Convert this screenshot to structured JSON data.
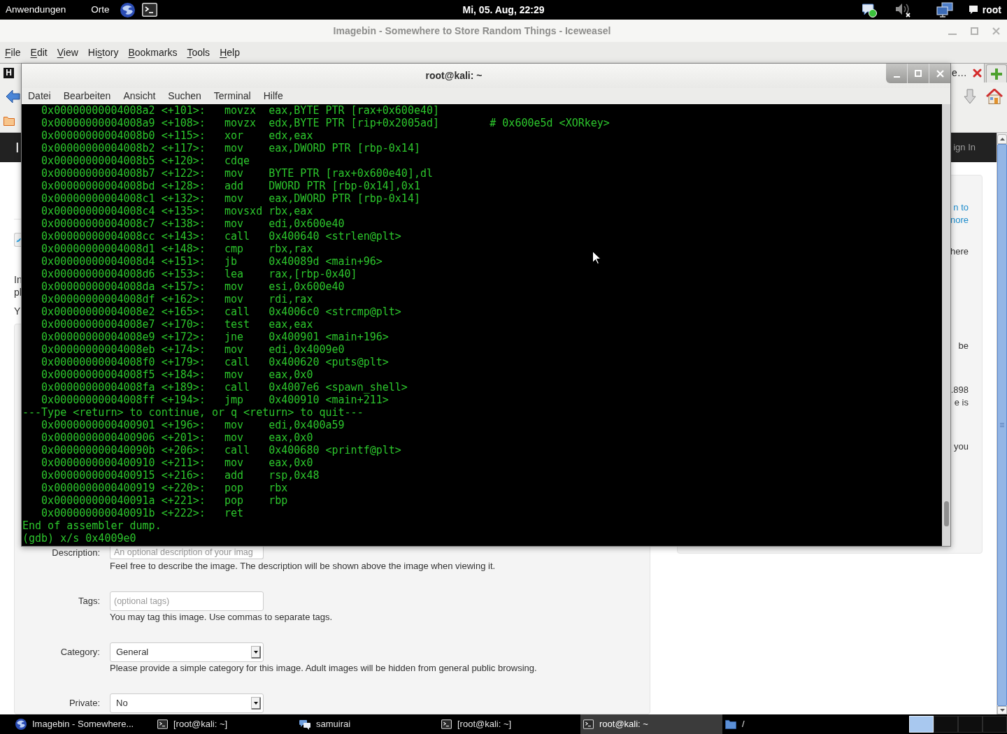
{
  "top_panel": {
    "menus": [
      "Anwendungen",
      "Orte"
    ],
    "clock": "Mi, 05. Aug, 22:29",
    "user": "root"
  },
  "browser": {
    "title": "Imagebin - Somewhere to Store Random Things - Iceweasel",
    "active": false,
    "menu": [
      {
        "key": "F",
        "rest": "ile"
      },
      {
        "key": "E",
        "rest": "dit"
      },
      {
        "key": "V",
        "rest": "iew"
      },
      {
        "lead": "Hi",
        "key": "s",
        "rest": "tory"
      },
      {
        "key": "B",
        "rest": "ookmarks"
      },
      {
        "key": "T",
        "rest": "ools"
      },
      {
        "key": "H",
        "rest": "elp"
      }
    ],
    "tab": {
      "favicon_letter": "H",
      "title_end": "e…"
    },
    "header": {
      "site_title_start": "I",
      "sign_in_end": "ign In"
    },
    "content": {
      "paragraph_line_starts": [
        "In",
        "pl"
      ],
      "note_start": "Y"
    },
    "sidebar_paragraphs": [
      {
        "kind": "link",
        "lines": [
          "n to",
          "nore"
        ]
      },
      {
        "kind": "text",
        "lines": [
          "here"
        ]
      },
      {
        "kind": "text",
        "lines": [
          "be"
        ]
      },
      {
        "kind": "text",
        "lines": [
          ".898",
          "e is"
        ]
      },
      {
        "kind": "text",
        "lines": [
          "you"
        ]
      }
    ],
    "form": [
      {
        "kind": "input",
        "label": "Description:",
        "placeholder": "An optional description of your imag",
        "help": "Feel free to describe the image. The description will be shown above the image when viewing it."
      },
      {
        "kind": "input",
        "label": "Tags:",
        "placeholder": "(optional tags)",
        "help": "You may tag this image. Use commas to separate tags."
      },
      {
        "kind": "select",
        "label": "Category:",
        "value": "General",
        "help": "Please provide a simple category for this image. Adult images will be hidden from general public browsing."
      },
      {
        "kind": "select",
        "label": "Private:",
        "value": "No"
      }
    ]
  },
  "terminal": {
    "title": "root@kali: ~",
    "active": true,
    "menu": [
      "Datei",
      "Bearbeiten",
      "Ansicht",
      "Suchen",
      "Terminal",
      "Hilfe"
    ],
    "lines": [
      "   0x00000000004008a2 <+101>:   movzx  eax,BYTE PTR [rax+0x600e40]",
      "   0x00000000004008a9 <+108>:   movzx  edx,BYTE PTR [rip+0x2005ad]        # 0x600e5d <XORkey>",
      "   0x00000000004008b0 <+115>:   xor    edx,eax",
      "   0x00000000004008b2 <+117>:   mov    eax,DWORD PTR [rbp-0x14]",
      "   0x00000000004008b5 <+120>:   cdqe",
      "   0x00000000004008b7 <+122>:   mov    BYTE PTR [rax+0x600e40],dl",
      "   0x00000000004008bd <+128>:   add    DWORD PTR [rbp-0x14],0x1",
      "   0x00000000004008c1 <+132>:   mov    eax,DWORD PTR [rbp-0x14]",
      "   0x00000000004008c4 <+135>:   movsxd rbx,eax",
      "   0x00000000004008c7 <+138>:   mov    edi,0x600e40",
      "   0x00000000004008cc <+143>:   call   0x400640 <strlen@plt>",
      "   0x00000000004008d1 <+148>:   cmp    rbx,rax",
      "   0x00000000004008d4 <+151>:   jb     0x40089d <main+96>",
      "   0x00000000004008d6 <+153>:   lea    rax,[rbp-0x40]",
      "   0x00000000004008da <+157>:   mov    esi,0x600e40",
      "   0x00000000004008df <+162>:   mov    rdi,rax",
      "   0x00000000004008e2 <+165>:   call   0x4006c0 <strcmp@plt>",
      "   0x00000000004008e7 <+170>:   test   eax,eax",
      "   0x00000000004008e9 <+172>:   jne    0x400901 <main+196>",
      "   0x00000000004008eb <+174>:   mov    edi,0x4009e0",
      "   0x00000000004008f0 <+179>:   call   0x400620 <puts@plt>",
      "   0x00000000004008f5 <+184>:   mov    eax,0x0",
      "   0x00000000004008fa <+189>:   call   0x4007e6 <spawn_shell>",
      "   0x00000000004008ff <+194>:   jmp    0x400910 <main+211>",
      "---Type <return> to continue, or q <return> to quit---",
      "   0x0000000000400901 <+196>:   mov    edi,0x400a59",
      "   0x0000000000400906 <+201>:   mov    eax,0x0",
      "   0x000000000040090b <+206>:   call   0x400680 <printf@plt>",
      "   0x0000000000400910 <+211>:   mov    eax,0x0",
      "   0x0000000000400915 <+216>:   add    rsp,0x48",
      "   0x0000000000400919 <+220>:   pop    rbx",
      "   0x000000000040091a <+221>:   pop    rbp",
      "   0x000000000040091b <+222>:   ret",
      "End of assembler dump.",
      "(gdb) x/s 0x4009e0"
    ]
  },
  "taskbar": {
    "items": [
      {
        "kind": "browser",
        "label": "Imagebin - Somewhere...",
        "selected": false
      },
      {
        "kind": "terminal",
        "label": "[root@kali: ~]",
        "selected": false
      },
      {
        "kind": "chat",
        "label": "samuirai",
        "selected": false
      },
      {
        "kind": "terminal",
        "label": "[root@kali: ~]",
        "selected": false
      },
      {
        "kind": "terminal",
        "label": "root@kali: ~",
        "selected": true
      },
      {
        "kind": "folder",
        "label": "/",
        "selected": false
      }
    ],
    "workspaces": [
      {
        "selected": true
      },
      {
        "selected": false
      },
      {
        "selected": false
      },
      {
        "selected": false
      }
    ]
  }
}
